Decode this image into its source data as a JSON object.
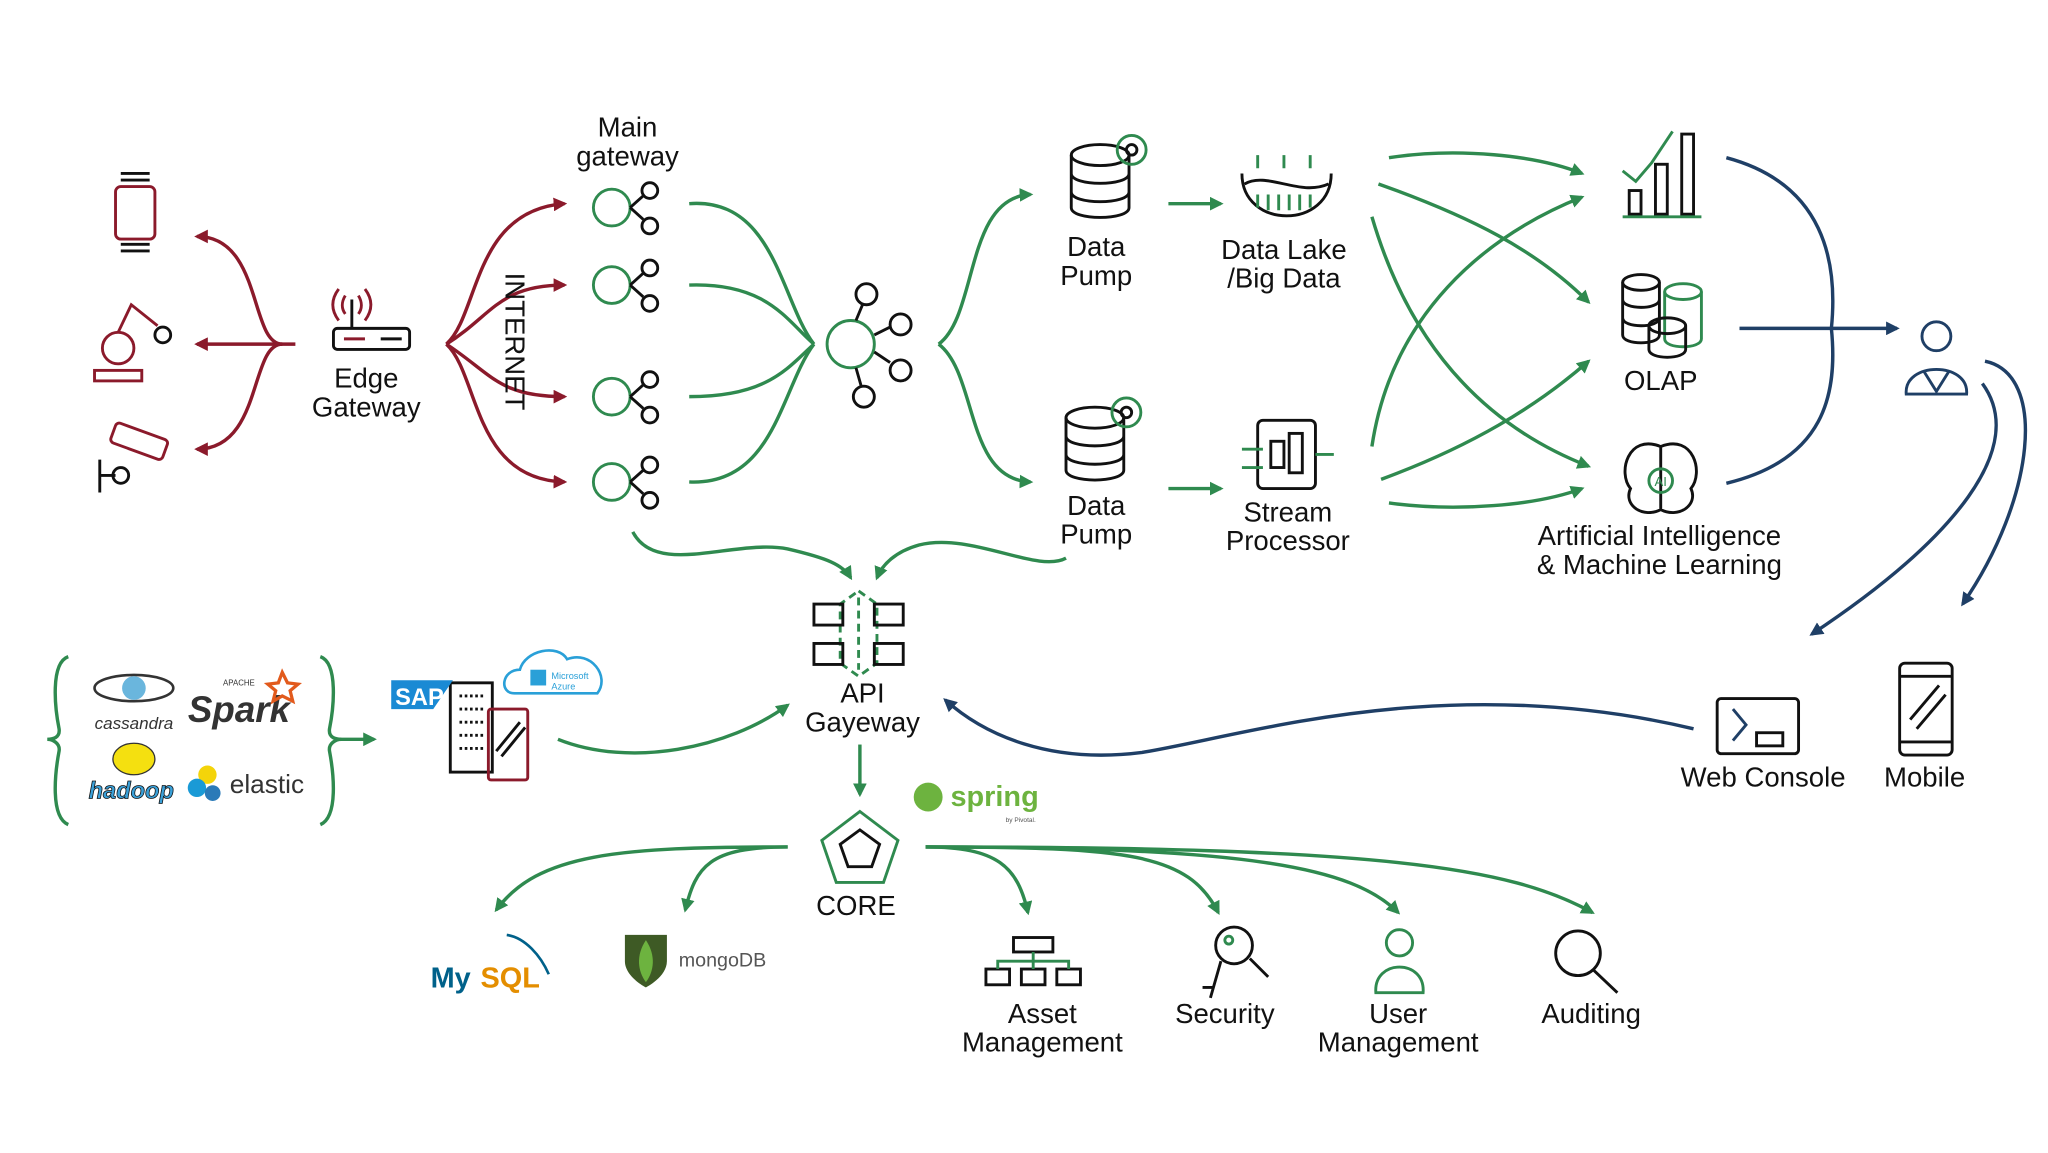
{
  "colors": {
    "device_links": "#8b1a2b",
    "data_flow": "#2f8a4f",
    "client_links": "#1f3f66"
  },
  "labels": {
    "main_gateway": [
      "Main",
      "gateway"
    ],
    "edge_gateway": [
      "Edge",
      "Gateway"
    ],
    "internet": "INTERNET",
    "data_pump_1": [
      "Data",
      "Pump"
    ],
    "data_pump_2": [
      "Data",
      "Pump"
    ],
    "data_lake": [
      "Data Lake",
      "/Big Data"
    ],
    "stream_processor": [
      "Stream",
      "Processor"
    ],
    "olap": "OLAP",
    "ai_ml": [
      "Artificial Intelligence",
      "& Machine Learning"
    ],
    "api_gateway": [
      "API",
      "Gayeway"
    ],
    "core": "CORE",
    "web_console": "Web Console",
    "mobile": "Mobile",
    "asset_management": [
      "Asset",
      "Management"
    ],
    "security": "Security",
    "user_management": [
      "User",
      "Management"
    ],
    "auditing": "Auditing"
  },
  "logos": {
    "cassandra": "cassandra",
    "spark_small": "APACHE",
    "spark": "Spark",
    "hadoop": "hadoop",
    "elastic": "elastic",
    "sap": "SAP",
    "azure": [
      "Microsoft",
      "Azure"
    ],
    "spring": "spring",
    "spring_sub": "by Pivotal.",
    "mysql_a": "My",
    "mysql_b": "SQL",
    "mongodb": "mongoDB",
    "ai_badge": "AI"
  },
  "icons": [
    "smartwatch-icon",
    "robot-arm-icon",
    "security-camera-icon",
    "router-icon",
    "node-graph-icon",
    "hub-icon",
    "database-gear-icon",
    "data-lake-icon",
    "stream-processor-icon",
    "bar-chart-icon",
    "olap-cubes-icon",
    "brain-icon",
    "user-icon",
    "api-gateway-icon",
    "core-pentagon-icon",
    "terminal-icon",
    "mobile-icon",
    "building-icon",
    "hierarchy-icon",
    "key-icon",
    "user-icon",
    "magnifier-icon"
  ]
}
